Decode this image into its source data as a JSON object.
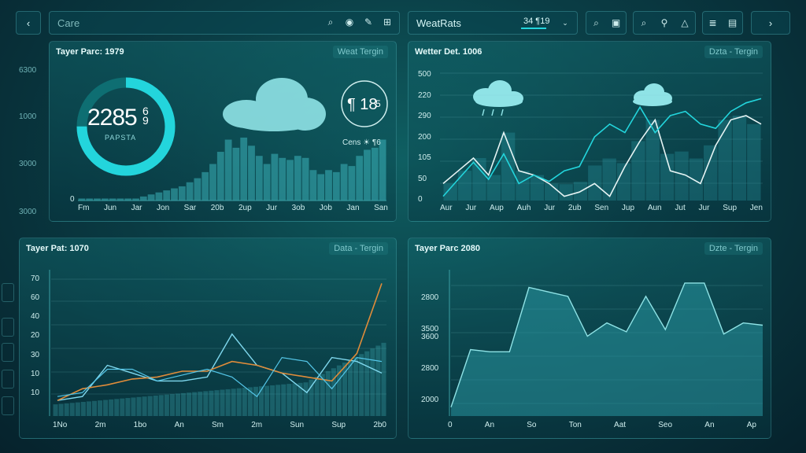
{
  "toolbar": {
    "back_label": "‹",
    "search_placeholder": "Care",
    "right_search_value": "WeatRats",
    "counter_value": "34 ¶19",
    "forward_label": "›"
  },
  "left_axis": {
    "ticks": [
      "6300",
      "1000",
      "3000",
      "3000"
    ]
  },
  "panels": {
    "p1": {
      "title": "Tayer Parc: 1979",
      "badge": "Weat Tergin",
      "gauge_value": "2285",
      "gauge_unit": "6 9",
      "gauge_label": "PAPSTA",
      "gauge_fraction": 0.75,
      "small_value": "¶ 18",
      "small_unit": "5",
      "weather_text": "Cens ☀ ¶6",
      "xticks": [
        "Fm",
        "Jun",
        "Jar",
        "Jon",
        "Sar",
        "20b",
        "2up",
        "Jur",
        "3ob",
        "Job",
        "Jan",
        "San"
      ],
      "y_zero": "0"
    },
    "p2": {
      "title": "Wetter Det. 1006",
      "badge": "Dzta - Tergin",
      "yticks": [
        "500",
        "220",
        "290",
        "200",
        "105",
        "50",
        "0"
      ],
      "xticks": [
        "Aur",
        "Jur",
        "Aup",
        "Auh",
        "Jur",
        "2ub",
        "Sen",
        "Jup",
        "Aun",
        "Jut",
        "Jur",
        "Sup",
        "Jen"
      ]
    },
    "p3": {
      "title": "Tayer Pat: 1070",
      "badge": "Data - Tergin",
      "yticks": [
        "70",
        "60",
        "40",
        "20",
        "30",
        "10",
        "10"
      ],
      "xticks": [
        "1No",
        "2m",
        "1bo",
        "An",
        "Sm",
        "2m",
        "Sun",
        "Sup",
        "2b0"
      ]
    },
    "p4": {
      "title": "Tayer Parc 2080",
      "badge": "Dzte - Tergin",
      "yticks": [
        "2800",
        "3500",
        "2800",
        "2000"
      ],
      "y_overlap": "3600",
      "xticks": [
        "0",
        "An",
        "So",
        "Ton",
        "Aat",
        "Seo",
        "An",
        "Ap"
      ]
    }
  },
  "chart_data": [
    {
      "type": "bar",
      "series": [
        {
          "values": [
            1,
            1,
            1,
            1,
            1,
            1,
            1,
            1,
            2,
            3,
            4,
            5,
            6,
            7,
            9,
            11,
            14,
            18,
            24,
            30,
            26,
            31,
            27,
            22,
            18,
            23,
            21,
            20,
            22,
            21,
            15,
            13,
            15,
            14,
            18,
            17,
            22,
            25,
            26,
            30
          ]
        }
      ],
      "ylim": [
        0,
        55
      ]
    },
    {
      "type": "line",
      "series": [
        {
          "values": [
            40,
            70,
            100,
            60,
            160,
            70,
            60,
            40,
            10,
            20,
            40,
            10,
            80,
            140,
            190,
            70,
            60,
            40,
            130,
            190,
            200,
            180
          ]
        },
        {
          "values": [
            10,
            50,
            90,
            50,
            110,
            40,
            60,
            45,
            70,
            80,
            150,
            180,
            160,
            220,
            160,
            200,
            210,
            180,
            170,
            210,
            230,
            240
          ]
        }
      ],
      "ylim": [
        0,
        300
      ]
    },
    {
      "type": "line",
      "series": [
        {
          "values": [
            8,
            10,
            26,
            22,
            18,
            18,
            20,
            42,
            26,
            22,
            12,
            30,
            28,
            22
          ]
        },
        {
          "values": [
            8,
            14,
            16,
            19,
            20,
            23,
            23,
            28,
            26,
            22,
            20,
            18,
            32,
            68
          ]
        },
        {
          "values": [
            10,
            12,
            24,
            24,
            18,
            21,
            24,
            20,
            10,
            30,
            28,
            14,
            30,
            28
          ]
        }
      ],
      "ylim": [
        0,
        75
      ]
    },
    {
      "type": "area",
      "series": [
        {
          "values": [
            200,
            1500,
            1450,
            1450,
            2900,
            2800,
            2700,
            1800,
            2100,
            1900,
            2700,
            1950,
            3000,
            3000,
            1850,
            2100,
            2050
          ]
        }
      ],
      "ylim": [
        0,
        3300
      ]
    }
  ],
  "colors": {
    "cyan": "#23d5dc",
    "orange": "#e08c3a",
    "white": "#e6f4f4",
    "line_blue": "#54c6e8"
  }
}
